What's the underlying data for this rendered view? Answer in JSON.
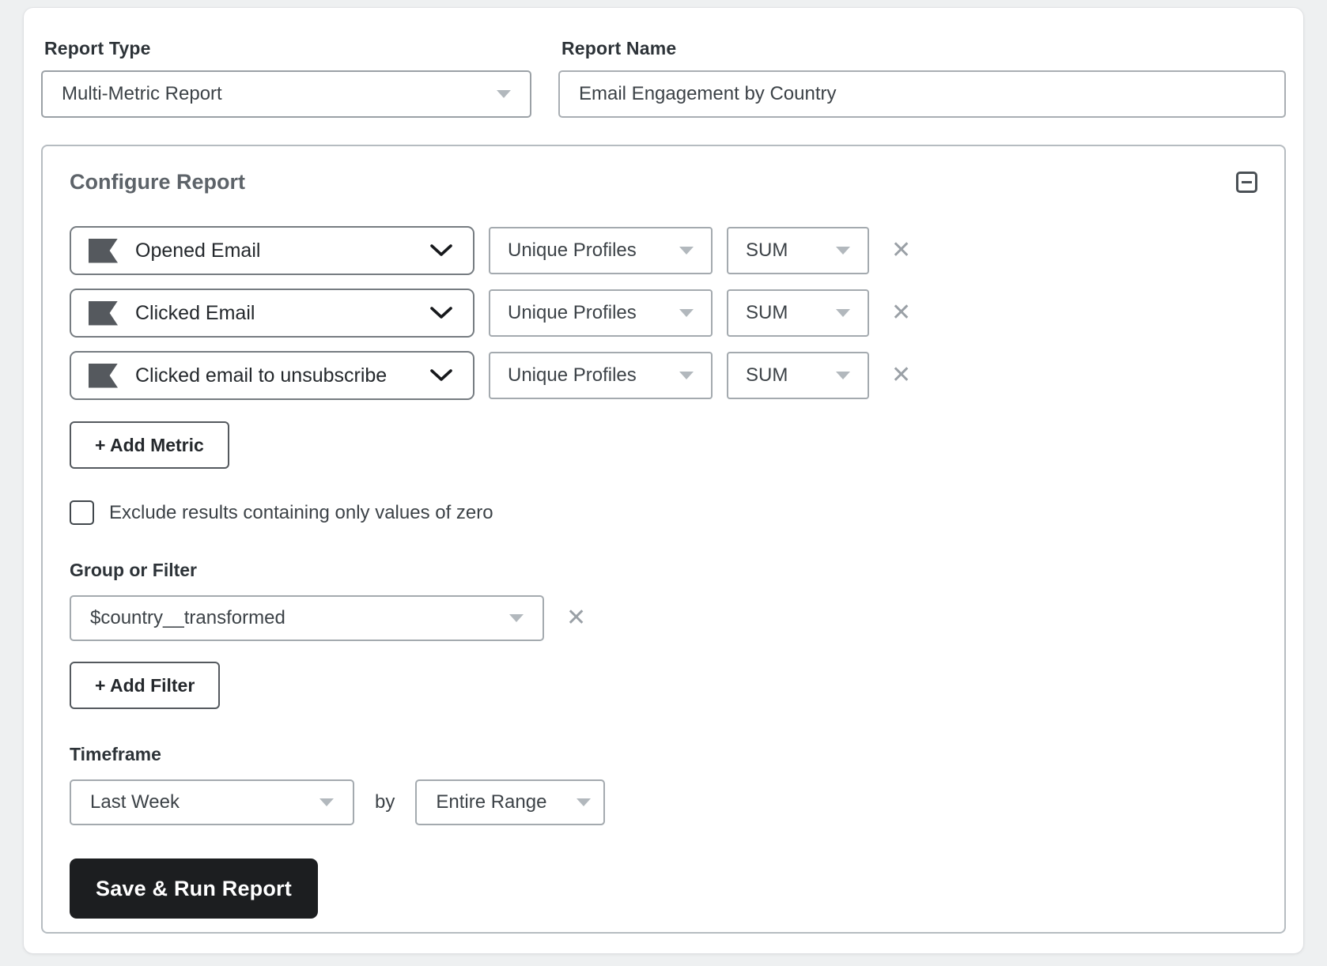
{
  "report_header": {
    "report_type_label": "Report Type",
    "report_type_value": "Multi-Metric Report",
    "report_name_label": "Report Name",
    "report_name_value": "Email Engagement by Country"
  },
  "configure": {
    "title": "Configure Report",
    "metrics": [
      {
        "name": "Opened Email",
        "measurement": "Unique Profiles",
        "aggregation": "SUM",
        "remove_label": "✕"
      },
      {
        "name": "Clicked Email",
        "measurement": "Unique Profiles",
        "aggregation": "SUM",
        "remove_label": "✕"
      },
      {
        "name": "Clicked email to unsubscribe",
        "measurement": "Unique Profiles",
        "aggregation": "SUM",
        "remove_label": "✕"
      }
    ],
    "add_metric_label": "+ Add Metric",
    "exclude_zero": {
      "label": "Exclude results containing only values of zero",
      "checked": false
    },
    "group_or_filter": {
      "label": "Group or Filter",
      "value": "$country__transformed",
      "remove_label": "✕",
      "add_filter_label": "+ Add Filter"
    },
    "timeframe": {
      "label": "Timeframe",
      "range_value": "Last Week",
      "by_label": "by",
      "granularity_value": "Entire Range"
    },
    "save_button_label": "Save & Run Report"
  },
  "colors": {
    "primary_button_bg": "#1c1e20",
    "text_primary": "#2d3338",
    "heading_gray": "#5d6369",
    "border_light": "#a4aaaf",
    "border_dark": "#767c81",
    "icon_gray": "#9aa0a6",
    "flag_icon": "#55595e",
    "page_bg": "#eef0f1"
  }
}
